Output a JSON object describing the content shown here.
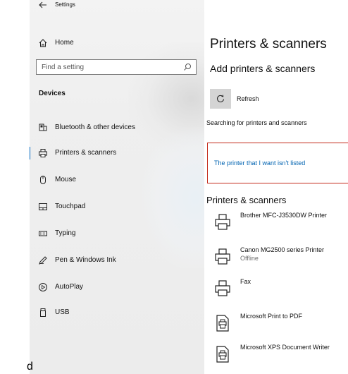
{
  "window": {
    "title": "Settings"
  },
  "sidebar": {
    "home_label": "Home",
    "search_placeholder": "Find a setting",
    "section_heading": "Devices",
    "items": [
      {
        "label": "Bluetooth & other devices",
        "icon": "bluetooth-device-icon"
      },
      {
        "label": "Printers & scanners",
        "icon": "printer-icon",
        "selected": true
      },
      {
        "label": "Mouse",
        "icon": "mouse-icon"
      },
      {
        "label": "Touchpad",
        "icon": "touchpad-icon"
      },
      {
        "label": "Typing",
        "icon": "keyboard-icon"
      },
      {
        "label": "Pen & Windows Ink",
        "icon": "pen-icon"
      },
      {
        "label": "AutoPlay",
        "icon": "autoplay-icon"
      },
      {
        "label": "USB",
        "icon": "usb-icon"
      }
    ]
  },
  "main": {
    "page_title": "Printers & scanners",
    "add_heading": "Add printers & scanners",
    "refresh_label": "Refresh",
    "searching_text": "Searching for printers and scanners",
    "not_listed_link": "The printer that I want isn't listed",
    "printers_heading": "Printers & scanners",
    "printers": [
      {
        "name": "Brother MFC-J3530DW Printer",
        "status": "",
        "icon": "printer-icon"
      },
      {
        "name": "Canon MG2500 series Printer",
        "status": "Offline",
        "icon": "printer-icon"
      },
      {
        "name": "Fax",
        "status": "",
        "icon": "printer-icon"
      },
      {
        "name": "Microsoft Print to PDF",
        "status": "",
        "icon": "pdf-printer-icon"
      },
      {
        "name": "Microsoft XPS Document Writer",
        "status": "",
        "icon": "pdf-printer-icon"
      }
    ]
  },
  "stray_text": "d",
  "colors": {
    "accent": "#0067c0",
    "link": "#0063b1",
    "focus_border": "#c42b1c"
  }
}
